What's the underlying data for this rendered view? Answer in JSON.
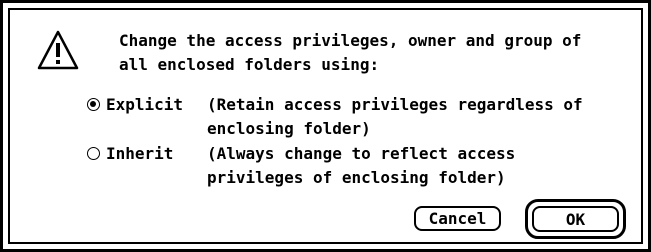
{
  "dialog": {
    "icon": "caution-icon",
    "message": "Change the access privileges, owner and group of\nall enclosed folders using:",
    "options": [
      {
        "label": "Explicit",
        "description": "(Retain access privileges regardless of\nenclosing folder)",
        "selected": true
      },
      {
        "label": "Inherit",
        "description": "(Always change to reflect access\nprivileges of enclosing folder)",
        "selected": false
      }
    ],
    "buttons": {
      "cancel": "Cancel",
      "ok": "OK"
    }
  }
}
